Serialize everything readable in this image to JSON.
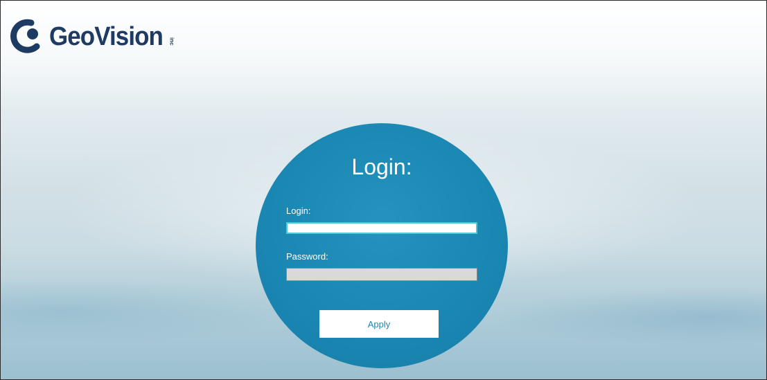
{
  "brand": {
    "name": "GeoVision",
    "suffix": "inc",
    "colors": {
      "logo_text": "#1e3b63",
      "circle": "#1a86b2",
      "field_focus_border": "#4fc9d6"
    }
  },
  "login_form": {
    "title": "Login:",
    "login_label": "Login:",
    "login_value": "",
    "password_label": "Password:",
    "password_value": "",
    "apply_label": "Apply"
  }
}
